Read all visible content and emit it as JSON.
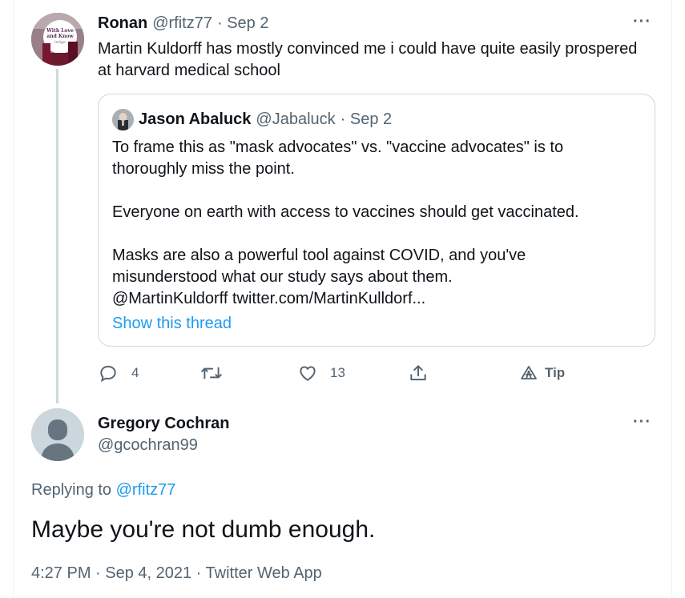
{
  "tweet1": {
    "display_name": "Ronan",
    "handle": "@rfitz77",
    "date": "· Sep 2",
    "text_line1": "Martin Kuldorff has mostly convinced me i could have quite easily prospered",
    "text_line2": "at harvard medical school",
    "more": "···",
    "avatar_text": "With Love and Knowledge"
  },
  "quote": {
    "display_name": "Jason Abaluck",
    "handle": "@Jabaluck",
    "date": "· Sep 2",
    "p1_line1": "To frame this as \"mask advocates\" vs. \"vaccine advocates\" is to",
    "p1_line2": "thoroughly miss the point.",
    "p2": "Everyone on earth with access to vaccines should get vaccinated.",
    "p3_line1": "Masks are also a powerful tool against COVID, and you've",
    "p3_line2": "misunderstood what our study says about them.",
    "p3_line3": "@MartinKuldorff twitter.com/MartinKulldorf...",
    "show_thread": "Show this thread"
  },
  "actions": {
    "reply_count": "4",
    "retweet_count": "",
    "like_count": "13",
    "tip_label": "Tip"
  },
  "tweet2": {
    "display_name": "Gregory Cochran",
    "handle": "@gcochran99",
    "more": "···",
    "replying_prefix": "Replying to",
    "replying_handle": "@rfitz77",
    "text": "Maybe you're not dumb enough.",
    "timestamp": "4:27 PM · Sep 4, 2021 · Twitter Web App"
  },
  "colors": {
    "accent": "#1d9bf0",
    "muted": "#536471",
    "border": "#cfd9de"
  }
}
